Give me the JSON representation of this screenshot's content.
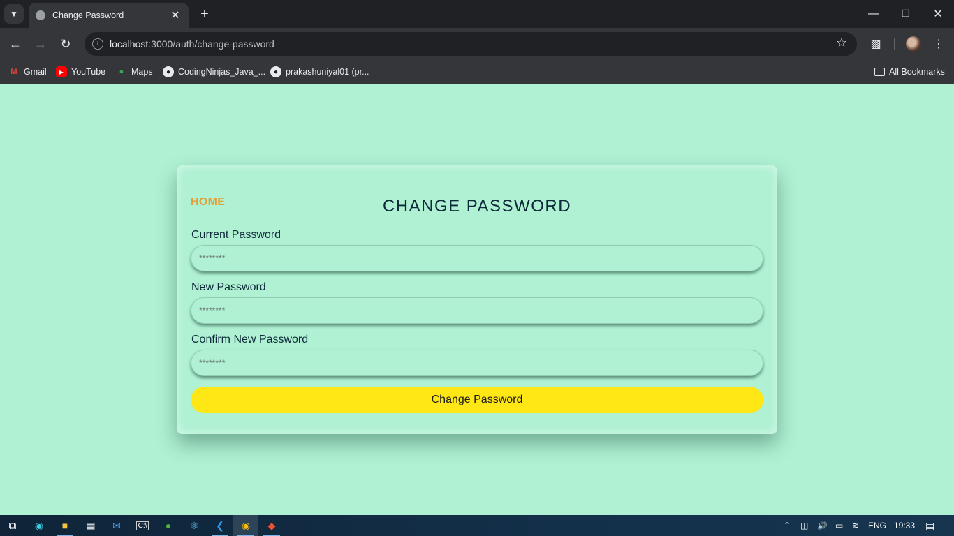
{
  "browser": {
    "tab_title": "Change Password",
    "url_host": "localhost",
    "url_path": ":3000/auth/change-password",
    "bookmarks": [
      {
        "label": "Gmail",
        "icon": "gmail-icon"
      },
      {
        "label": "YouTube",
        "icon": "youtube-icon"
      },
      {
        "label": "Maps",
        "icon": "maps-icon"
      },
      {
        "label": "CodingNinjas_Java_...",
        "icon": "github-icon"
      },
      {
        "label": "prakashuniyal01 (pr...",
        "icon": "github-icon"
      }
    ],
    "all_bookmarks": "All Bookmarks"
  },
  "page": {
    "home_link": "HOME",
    "title": "CHANGE PASSWORD",
    "fields": [
      {
        "label": "Current Password",
        "placeholder": "********"
      },
      {
        "label": "New Password",
        "placeholder": "********"
      },
      {
        "label": "Confirm New Password",
        "placeholder": "********"
      }
    ],
    "submit_label": "Change Password"
  },
  "taskbar": {
    "language": "ENG",
    "time": "19:33"
  },
  "colors": {
    "page_background": "#aff1d2",
    "home_link": "#e0a13a",
    "submit_button": "#ffe716",
    "title_text": "#0e2a3a"
  }
}
